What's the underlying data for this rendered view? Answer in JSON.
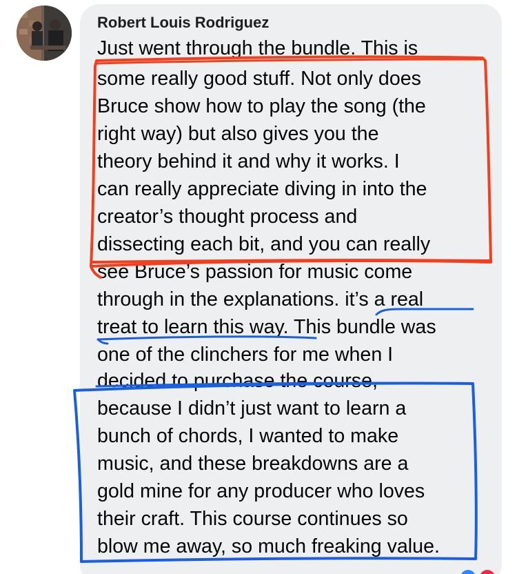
{
  "comment": {
    "author": "Robert Louis Rodriguez",
    "lines": [
      "Just went through the bundle. This is",
      "some really good stuff. Not only does",
      "Bruce show how to play the song (the",
      "right way) but also gives you the",
      "theory behind it and why it works. I",
      "can really appreciate diving in into the",
      "creator’s thought process and",
      "dissecting each bit, and you can really",
      "see Bruce’s passion for music come",
      "through in the explanations. it’s a real",
      "treat to learn this way. This bundle was",
      "one of the clinchers for me when I",
      "decided to purchase the course,",
      "because I didn’t just want to learn a",
      "bunch of chords, I wanted to make",
      "music, and these breakdowns are a",
      "gold mine for any producer who loves",
      "their craft. This course continues so",
      "blow me away, so much freaking value."
    ]
  },
  "colors": {
    "bubble": "#eeeff1",
    "author": "#1c1e21",
    "text": "#050505",
    "red_markup": "#f0401f",
    "blue_markup": "#1a5fe0"
  },
  "icons": [
    "avatar-photo",
    "like-reaction-icon",
    "love-reaction-icon"
  ]
}
